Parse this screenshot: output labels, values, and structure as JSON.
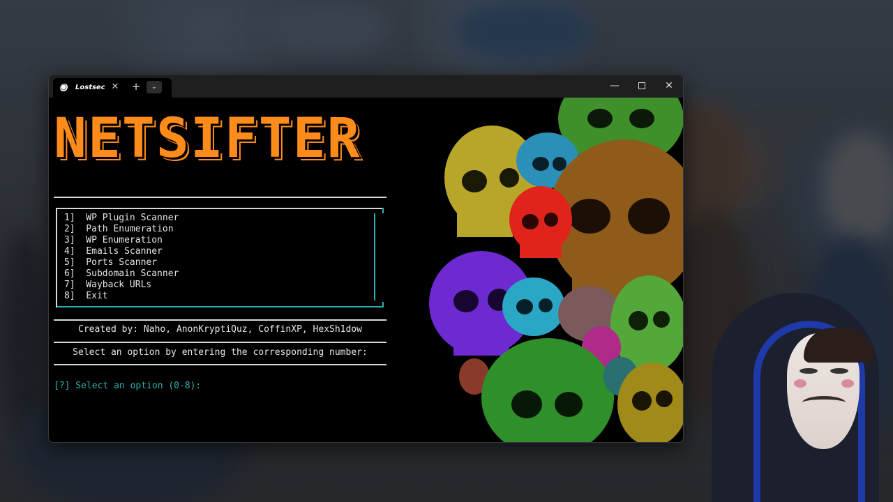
{
  "window": {
    "tab_title": "Lostsec",
    "tab_close_glyph": "✕",
    "new_tab_glyph": "+",
    "tab_dropdown_glyph": "⌄",
    "minimize_glyph": "—",
    "close_glyph": "✕"
  },
  "terminal": {
    "logo_text": "NETSIFTER",
    "menu_items": [
      "1]  WP Plugin Scanner",
      "2]  Path Enumeration",
      "3]  WP Enumeration",
      "4]  Emails Scanner",
      "5]  Ports Scanner",
      "6]  Subdomain Scanner",
      "7]  Wayback URLs",
      "8]  Exit"
    ],
    "credits": "Created by: Naho, AnonKryptiQuz, CoffinXP, HexSh1dow",
    "instruction": "Select an option by entering the corresponding number:",
    "prompt": "[?] Select an option (0-8):"
  },
  "colors": {
    "logo": "#ff8c1a",
    "accent": "#2bb0b0",
    "text": "#e6e6e6"
  },
  "icons": {
    "tab_icon": "skull-logo-icon",
    "art": "skulls-illustration"
  }
}
